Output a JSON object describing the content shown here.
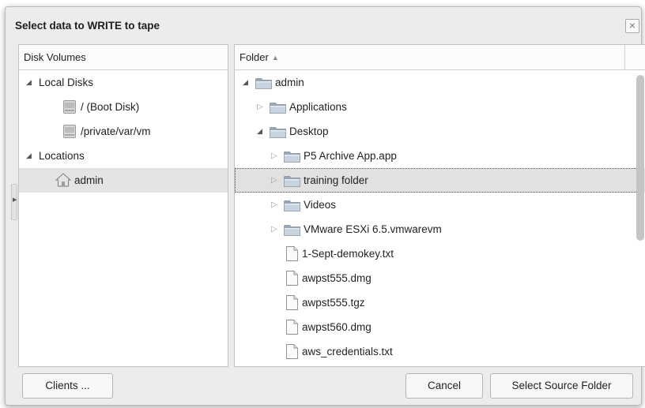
{
  "dialog": {
    "title": "Select data to WRITE to tape",
    "close_glyph": "×"
  },
  "left_pane": {
    "header": "Disk Volumes",
    "groups": [
      {
        "label": "Local Disks",
        "items": [
          "/ (Boot Disk)",
          "/private/var/vm"
        ]
      },
      {
        "label": "Locations",
        "items": [
          "admin"
        ]
      }
    ],
    "selected_item": "admin"
  },
  "right_pane": {
    "header": "Folder",
    "sort_indicator": "▲",
    "rows": [
      {
        "label": "admin",
        "kind": "folder",
        "depth": 0,
        "expander": "open"
      },
      {
        "label": "Applications",
        "kind": "folder",
        "depth": 1,
        "expander": "closed"
      },
      {
        "label": "Desktop",
        "kind": "folder",
        "depth": 1,
        "expander": "open"
      },
      {
        "label": "P5 Archive App.app",
        "kind": "folder",
        "depth": 2,
        "expander": "closed"
      },
      {
        "label": "training folder",
        "kind": "folder",
        "depth": 2,
        "expander": "closed",
        "selected": true
      },
      {
        "label": "Videos",
        "kind": "folder",
        "depth": 2,
        "expander": "closed"
      },
      {
        "label": "VMware ESXi 6.5.vmwarevm",
        "kind": "folder",
        "depth": 2,
        "expander": "closed"
      },
      {
        "label": "1-Sept-demokey.txt",
        "kind": "file",
        "depth": 2
      },
      {
        "label": "awpst555.dmg",
        "kind": "file",
        "depth": 2
      },
      {
        "label": "awpst555.tgz",
        "kind": "file",
        "depth": 2
      },
      {
        "label": "awpst560.dmg",
        "kind": "file",
        "depth": 2
      },
      {
        "label": "aws_credentials.txt",
        "kind": "file",
        "depth": 2
      }
    ]
  },
  "buttons": {
    "clients": "Clients ...",
    "cancel": "Cancel",
    "select_source": "Select Source Folder"
  },
  "icons": {
    "folder": "folder-icon",
    "file": "file-icon",
    "disk": "disk-icon",
    "home": "home-icon",
    "expand_open": "▲",
    "expand_closed": "▷"
  },
  "colors": {
    "dialog_bg": "#ececec",
    "pane_bg": "#ffffff",
    "selected_row": "#e3e3e3",
    "folder_tab": "#9aa8b6",
    "folder_body": "#c7d3de"
  }
}
